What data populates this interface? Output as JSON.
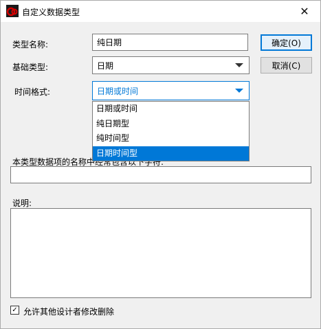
{
  "window": {
    "title": "自定义数据类型",
    "close_glyph": "✕"
  },
  "form": {
    "type_name_label": "类型名称:",
    "type_name_value": "纯日期",
    "base_type_label": "基础类型:",
    "base_type_value": "日期",
    "time_format_label": "时间格式:",
    "time_format_value": "日期或时间",
    "time_format_options": [
      "日期或时间",
      "纯日期型",
      "纯时间型",
      "日期时间型"
    ],
    "time_format_highlighted_index": 3,
    "name_list_label": "本类型数据项的名称中经常包含以下字符:",
    "name_list_value": "",
    "description_label": "说明:",
    "description_value": "",
    "allow_modify_label": "允许其他设计者修改删除",
    "allow_modify_checked": true,
    "check_glyph": "✓"
  },
  "buttons": {
    "ok_label": "确定(O)",
    "cancel_label": "取消(C)"
  },
  "colors": {
    "accent": "#0078d7",
    "icon_red": "#d40000"
  }
}
